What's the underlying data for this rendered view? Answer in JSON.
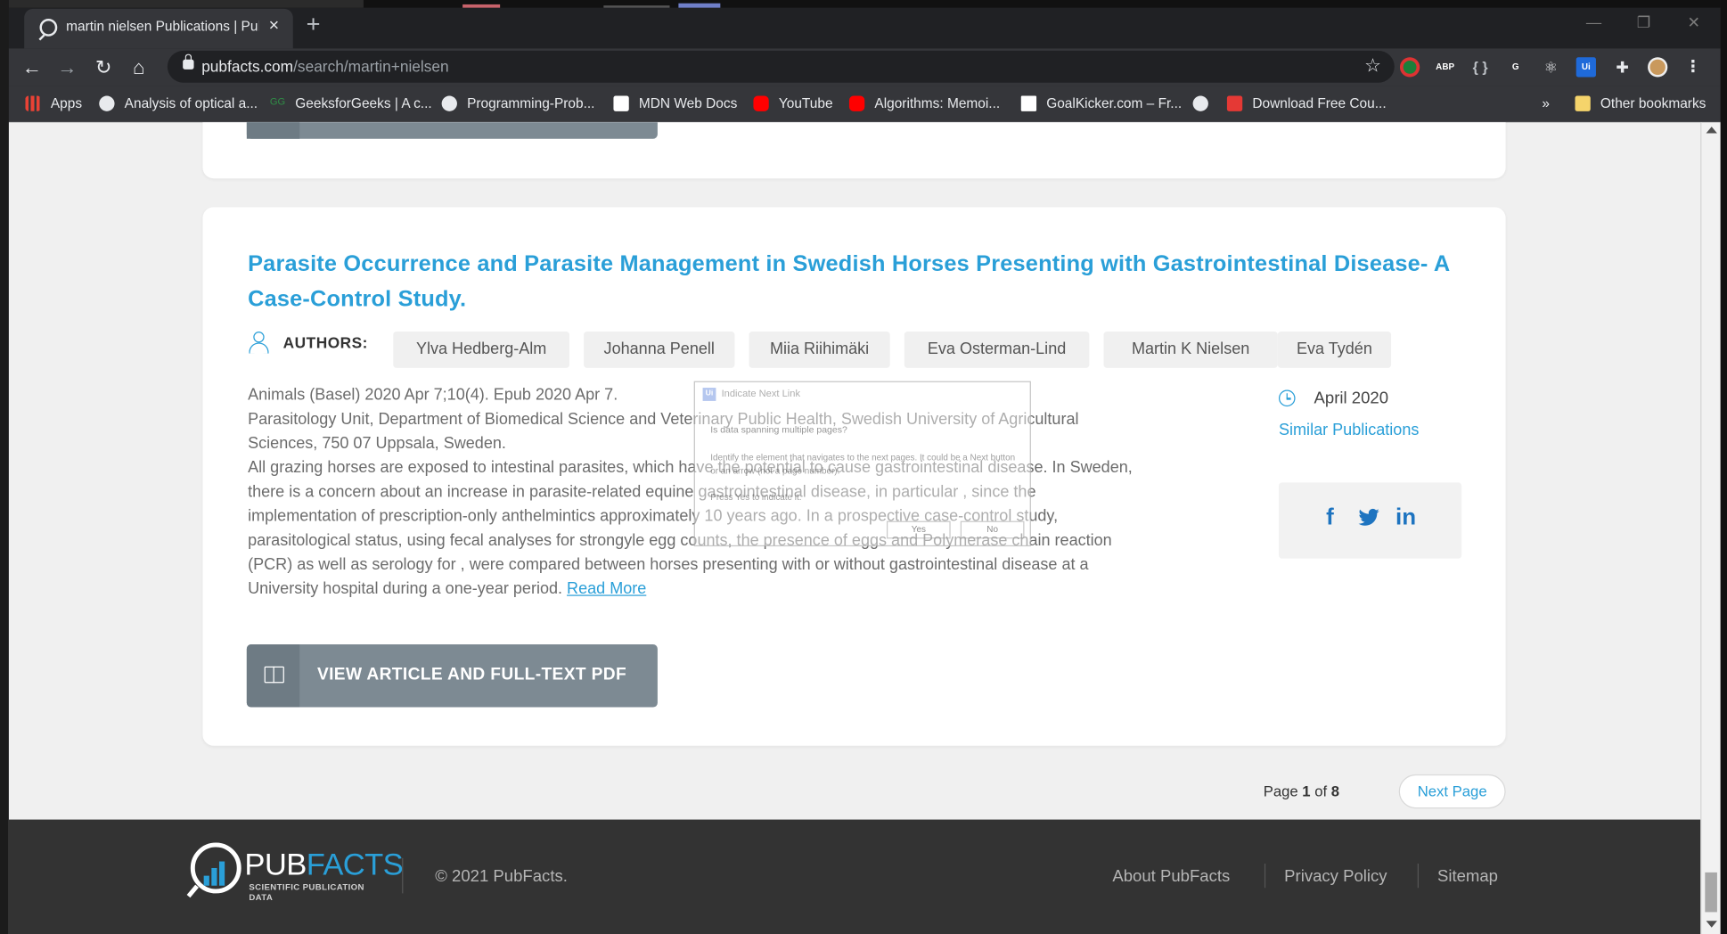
{
  "browser": {
    "tab_title": "martin nielsen Publications | Pub",
    "new_tab_label": "+",
    "window_controls": {
      "minimize": "—",
      "restore": "❐",
      "close": "✕"
    },
    "url_host": "pubfacts.com",
    "url_path": "/search/martin+nielsen",
    "extensions": [
      {
        "name": "abp",
        "label": "ABP",
        "color": "#e53935"
      },
      {
        "name": "grammarly",
        "label": "G",
        "color": "#15c39a"
      }
    ],
    "bookmarks": {
      "apps": "Apps",
      "items": [
        {
          "label": "Analysis of optical a...",
          "icon": "globe-icon"
        },
        {
          "label": "GeeksforGeeks | A c...",
          "icon": "gfg-icon"
        },
        {
          "label": "Programming-Prob...",
          "icon": "github-icon"
        },
        {
          "label": "MDN Web Docs",
          "icon": "mdn-icon"
        },
        {
          "label": "YouTube",
          "icon": "youtube-icon"
        },
        {
          "label": "Algorithms: Memoi...",
          "icon": "youtube-icon"
        },
        {
          "label": "GoalKicker.com – Fr...",
          "icon": "goalkicker-icon"
        },
        {
          "label": "Download Free Cou...",
          "icon": "fco-icon"
        }
      ],
      "overflow": "»",
      "other": "Other bookmarks"
    }
  },
  "article": {
    "title": "Parasite Occurrence and Parasite Management in Swedish Horses Presenting with Gastrointestinal Disease- A Case-Control Study.",
    "authors_label": "AUTHORS:",
    "authors": [
      "Ylva Hedberg-Alm",
      "Johanna Penell",
      "Miia Riihimäki",
      "Eva Osterman-Lind",
      "Martin K Nielsen",
      "Eva Tydén"
    ],
    "abstract_lines": [
      "Animals (Basel) 2020 Apr 7;10(4). Epub 2020 Apr 7.",
      "Parasitology Unit, Department of Biomedical Science and Veterinary Public Health, Swedish University of Agricultural",
      "Sciences, 750 07 Uppsala, Sweden.",
      "All grazing horses are exposed to intestinal parasites, which have the potential to cause gastrointestinal disease. In Sweden,",
      "there is a concern about an increase in parasite-related equine gastrointestinal disease, in particular , since the",
      "implementation of prescription-only anthelmintics approximately 10 years ago. In a prospective case-control study,",
      "parasitological status, using fecal analyses for strongyle egg counts, the presence of eggs and Polymerase chain reaction",
      "(PCR) as well as serology for , were compared between horses presenting with or without gastrointestinal disease at a",
      "University hospital during a one-year period."
    ],
    "read_more": "Read More",
    "date": "April 2020",
    "similar": "Similar Publications",
    "share": {
      "facebook": "f",
      "twitter": "🐦",
      "linkedin": "in"
    },
    "pdf_button": "VIEW ARTICLE AND FULL-TEXT PDF"
  },
  "pagination": {
    "page_prefix": "Page ",
    "current": "1",
    "of": " of ",
    "total": "8",
    "next": "Next Page"
  },
  "footer": {
    "brand_pub": "PUB",
    "brand_facts": "FACTS",
    "tagline": "SCIENTIFIC PUBLICATION DATA",
    "copyright": "© 2021 PubFacts.",
    "links": [
      "About PubFacts",
      "Privacy Policy",
      "Sitemap"
    ]
  },
  "dialog": {
    "title": "Indicate Next Link",
    "question": "Is data spanning multiple pages?",
    "description": "Identify the element that navigates to the next pages. It could be a Next button or an arrow (not a page number).",
    "press": "Press Yes to indicate it.",
    "yes": "Yes",
    "no": "No"
  },
  "colors": {
    "accent": "#2a9fd8",
    "button_gray": "#7d8a93",
    "footer_bg": "#333333"
  }
}
